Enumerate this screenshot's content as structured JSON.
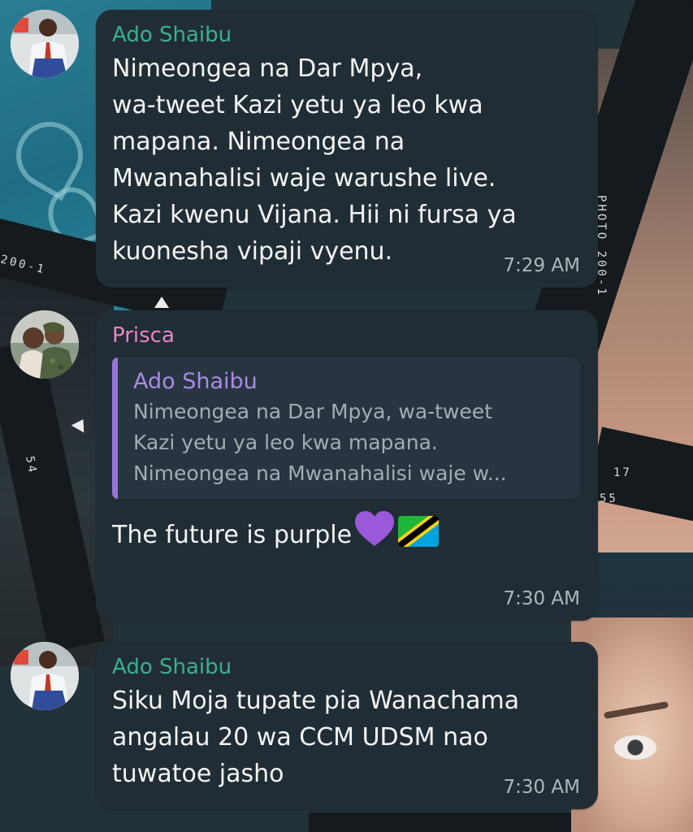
{
  "wallpaper": {
    "strip_texts": [
      "PHOTO 200-1",
      "200-1",
      "17",
      "55",
      "54"
    ]
  },
  "messages": [
    {
      "sender": "Ado Shaibu",
      "text": "Nimeongea na Dar Mpya,\nwa-tweet Kazi yetu ya leo kwa\nmapana. Nimeongea na\nMwanahalisi waje warushe live.\nKazi kwenu Vijana. Hii ni fursa ya\nkuonesha vipaji vyenu.",
      "time": "7:29 AM"
    },
    {
      "sender": "Prisca",
      "reply": {
        "sender": "Ado Shaibu",
        "text": "Nimeongea na Dar Mpya, wa-tweet\nKazi yetu ya leo kwa mapana.\nNimeongea na Mwanahalisi waje w..."
      },
      "text": "The future is purple",
      "emojis": [
        "purple-heart-icon",
        "tanzania-flag-icon"
      ],
      "time": "7:30 AM"
    },
    {
      "sender": "Ado Shaibu",
      "text": "Siku Moja tupate pia Wanachama\nangalau 20 wa CCM UDSM nao\ntuwatoe jasho",
      "time": "7:30 AM"
    }
  ],
  "colors": {
    "bubble": "#212d35",
    "sender_green": "#3ab08f",
    "sender_pink": "#e785c7",
    "quote_accent": "#9a73d8",
    "time": "#aeb7bc"
  }
}
